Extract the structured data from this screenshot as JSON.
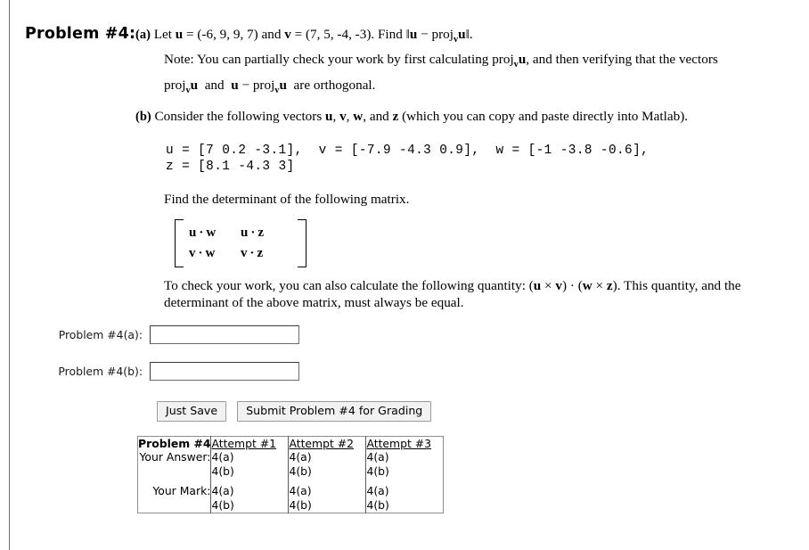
{
  "problem": {
    "title": "Problem #4:",
    "parts": {
      "a": {
        "label": "(a)",
        "statement_pre": "Let ",
        "u_def": "u = (-6, 9, 9, 7)",
        "and": " and ",
        "v_def": "v = (7, 5, -4, -3)",
        "find": ". Find ",
        "expression": "‖u − proj_v u‖",
        "note_line1": "Note: You can partially check your work by first calculating proj",
        "note_line1_sub": "v",
        "note_line1_end": "u, and then verifying that the vectors",
        "note_line2_a": "proj",
        "note_line2_sub": "v",
        "note_line2_b": "u  and  u − proj",
        "note_line2_c": "u  are orthogonal."
      },
      "b": {
        "label": "(b)",
        "statement": "Consider the following vectors u, v, w, and z (which you can copy and paste directly into Matlab).",
        "code": "u = [7 0.2 -3.1],  v = [-7.9 -4.3 0.9],  w = [-1 -3.8 -0.6],\nz = [8.1 -4.3 3]",
        "find_determinant": "Find the determinant of the following matrix.",
        "matrix": {
          "rows": [
            [
              "u",
              "w",
              "u",
              "z"
            ],
            [
              "v",
              "w",
              "v",
              "z"
            ]
          ],
          "dot": "·"
        },
        "check_line1": "To check your work, you can also calculate the following quantity: (u × v) · (w × z). This quantity, and the",
        "check_line2": "determinant of the above matrix, must always be equal."
      }
    }
  },
  "answers": [
    {
      "label": "Problem #4(a):",
      "value": "",
      "placeholder": ""
    },
    {
      "label": "Problem #4(b):",
      "value": "",
      "placeholder": ""
    }
  ],
  "buttons": {
    "just_save": "Just Save",
    "submit": "Submit Problem #4 for Grading"
  },
  "attempts_table": {
    "corner_header": "Problem #4",
    "column_headers": [
      "Attempt #1",
      "Attempt #2",
      "Attempt #3"
    ],
    "rows": [
      {
        "label": "Your Answer:",
        "cells": [
          [
            "4(a)",
            "4(b)"
          ],
          [
            "4(a)",
            "4(b)"
          ],
          [
            "4(a)",
            "4(b)"
          ]
        ]
      },
      {
        "label": "Your Mark:",
        "cells": [
          [
            "4(a)",
            "4(b)"
          ],
          [
            "4(a)",
            "4(b)"
          ],
          [
            "4(a)",
            "4(b)"
          ]
        ]
      }
    ]
  },
  "colors": {
    "text": "#000000",
    "rule": "#6e6e72",
    "table_border": "#909090",
    "button_face": "#f2f2f2"
  }
}
